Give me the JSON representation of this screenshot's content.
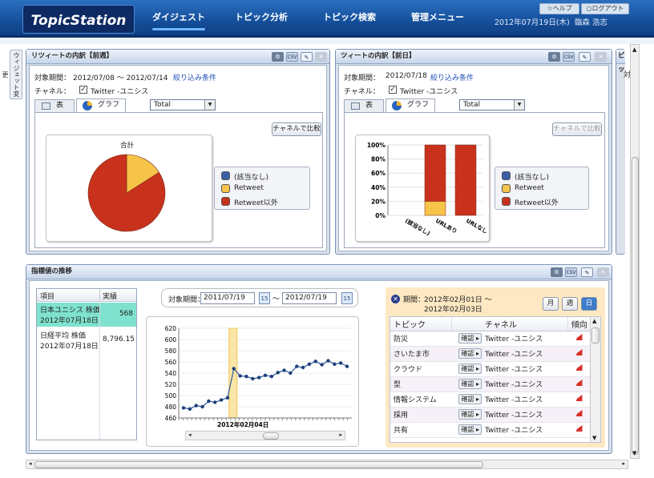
{
  "header": {
    "logo": "TopicStation",
    "nav": [
      {
        "label": "ダイジェスト",
        "active": true
      },
      {
        "label": "トピック分析",
        "active": false
      },
      {
        "label": "トピック検索",
        "active": false
      },
      {
        "label": "管理メニュー",
        "active": false
      }
    ],
    "help_label": "ヘルプ",
    "logout_label": "ログアウト",
    "date": "2012年07月19日(木)",
    "user": "臨森 浩志"
  },
  "sidebar_tab": "ウィジェット変更",
  "panel1": {
    "title": "リツィートの内訳【前週】",
    "period_label": "対象期間：",
    "period_value": "2012/07/08 ～ 2012/07/14",
    "filter_link": "絞り込み条件",
    "channel_label": "チャネル：",
    "channel_value": "Twitter -ユニシス",
    "tab_table": "表",
    "tab_graph": "グラフ",
    "select_value": "Total",
    "compare_button": "チャネルで比較",
    "pie_label": "合計"
  },
  "panel2": {
    "title": "ツィートの内訳【前日】",
    "period_label": "対象期間：",
    "period_value": "2012/07/18",
    "filter_link": "絞り込み条件",
    "channel_label": "チャネル：",
    "channel_value": "Twitter -ユニシス",
    "tab_table": "表",
    "tab_graph": "グラフ",
    "select_value": "Total",
    "compare_button": "チャネルで比較"
  },
  "panel3_title": "ビッ",
  "panel3_partial": "対",
  "legend": [
    {
      "label": "(該当なし)",
      "color": "#3b5fa8"
    },
    {
      "label": "Retweet",
      "color": "#f7c44a"
    },
    {
      "label": "Retweet以外",
      "color": "#c8321c"
    }
  ],
  "indicator": {
    "title": "指標値の推移",
    "col_item": "項目",
    "col_value": "実績",
    "rows": [
      {
        "name": "日本ユニシス 株価",
        "date": "2012年07月18日",
        "value": "568",
        "selected": true
      },
      {
        "name": "日経平均 株価",
        "date": "2012年07月18日",
        "value": "8,796.15",
        "selected": false
      }
    ],
    "period_label": "対象期間：",
    "date_from": "2011/07/19",
    "date_to": "2012/07/19",
    "range_sep": "～",
    "cal_icon_text": "15",
    "x_label": "2012年02月04日",
    "detail_period_label": "期間：",
    "detail_period_value": "2012年02月01日 ～",
    "detail_period_value2": "2012年02月03日",
    "btn_month": "月",
    "btn_week": "週",
    "btn_day": "日",
    "col_topic": "トピック",
    "col_channel": "チャネル",
    "col_trend": "傾向",
    "confirm_label": "確認",
    "topics": [
      {
        "topic": "防災",
        "channel": "Twitter -ユニシス"
      },
      {
        "topic": "さいたま市",
        "channel": "Twitter -ユニシス"
      },
      {
        "topic": "クラウド",
        "channel": "Twitter -ユニシス"
      },
      {
        "topic": "型",
        "channel": "Twitter -ユニシス"
      },
      {
        "topic": "情報システム",
        "channel": "Twitter -ユニシス"
      },
      {
        "topic": "採用",
        "channel": "Twitter -ユニシス"
      },
      {
        "topic": "共有",
        "channel": "Twitter -ユニシス"
      }
    ]
  },
  "chart_data": [
    {
      "type": "pie",
      "title": "合計",
      "labels": [
        "(該当なし)",
        "Retweet",
        "Retweet以外"
      ],
      "values": [
        0,
        16,
        84
      ],
      "colors": [
        "#3b5fa8",
        "#f7c44a",
        "#c8321c"
      ]
    },
    {
      "type": "bar",
      "stacked": true,
      "percent": true,
      "categories": [
        "(該当なし)",
        "URLあり",
        "URLなし"
      ],
      "series": [
        {
          "name": "(該当なし)",
          "values": [
            0,
            0,
            0
          ]
        },
        {
          "name": "Retweet",
          "values": [
            0,
            20,
            0
          ]
        },
        {
          "name": "Retweet以外",
          "values": [
            0,
            80,
            100
          ]
        }
      ],
      "ylim": [
        0,
        100
      ],
      "yticks": [
        "0%",
        "20%",
        "40%",
        "60%",
        "80%",
        "100%"
      ]
    },
    {
      "type": "line",
      "ylim": [
        460,
        620
      ],
      "yticks": [
        460,
        480,
        500,
        520,
        540,
        560,
        580,
        600,
        620
      ],
      "xlabel": "2012年02月04日",
      "highlight_index": 8,
      "values": [
        478,
        476,
        482,
        480,
        490,
        488,
        492,
        496,
        548,
        535,
        534,
        530,
        532,
        536,
        534,
        541,
        545,
        540,
        552,
        550,
        556,
        561,
        555,
        562,
        556,
        558,
        552
      ]
    }
  ]
}
